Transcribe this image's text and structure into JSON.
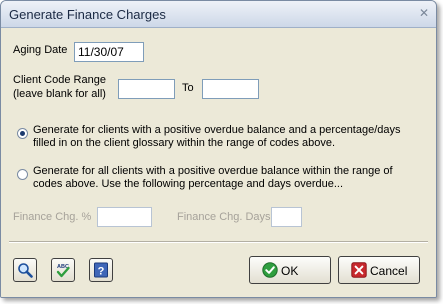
{
  "window": {
    "title": "Generate Finance Charges",
    "close_glyph": "✕"
  },
  "aging": {
    "label": "Aging Date",
    "value": "11/30/07"
  },
  "client_range": {
    "label_line1": "Client Code Range",
    "label_line2": "(leave blank for all)",
    "from_value": "",
    "to_label": "To",
    "to_value": ""
  },
  "options": [
    {
      "line1": "Generate for clients with a positive overdue balance and a percentage/days",
      "line2": "filled in on the client glossary within the range of codes above.",
      "checked": true
    },
    {
      "line1": "Generate for all clients with a positive overdue balance within the range of",
      "line2": "codes above.  Use the following percentage and days overdue...",
      "checked": false
    }
  ],
  "finance": {
    "pct_label": "Finance Chg. %",
    "pct_value": "",
    "days_label": "Finance Chg. Days",
    "days_value": ""
  },
  "toolbar": {
    "icons": [
      "magnifier-icon",
      "spell-check-icon",
      "help-icon"
    ],
    "ok_label": "OK",
    "cancel_label": "Cancel"
  },
  "colors": {
    "ok_green": "#2f9e3f",
    "cancel_red": "#c8282d",
    "title_bar": "#cdd8e8"
  }
}
